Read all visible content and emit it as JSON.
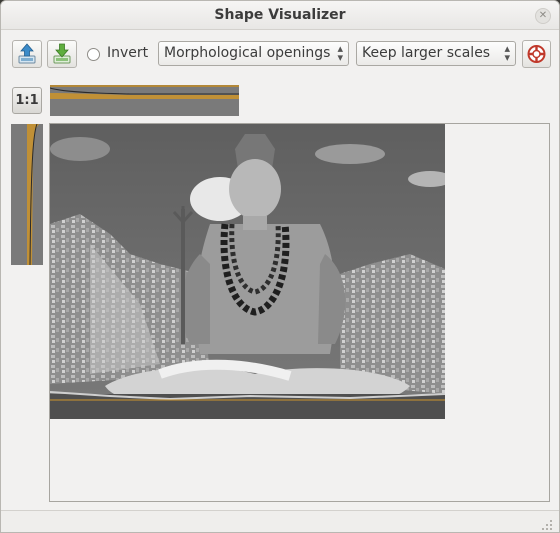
{
  "window": {
    "title": "Shape Visualizer"
  },
  "toolbar": {
    "load_icon": "upload-arrow-icon",
    "save_icon": "download-arrow-icon",
    "invert_label": "Invert",
    "invert_checked": false,
    "filter_select": {
      "value": "Morphological openings"
    },
    "scale_select": {
      "value": "Keep larger scales"
    },
    "help_icon": "lifebuoy-icon"
  },
  "zoom": {
    "label": "1:1"
  },
  "colors": {
    "window_bg": "#f2f1f0",
    "accent_orange": "#d29a3a",
    "plot_bg": "#7a7a7a"
  }
}
